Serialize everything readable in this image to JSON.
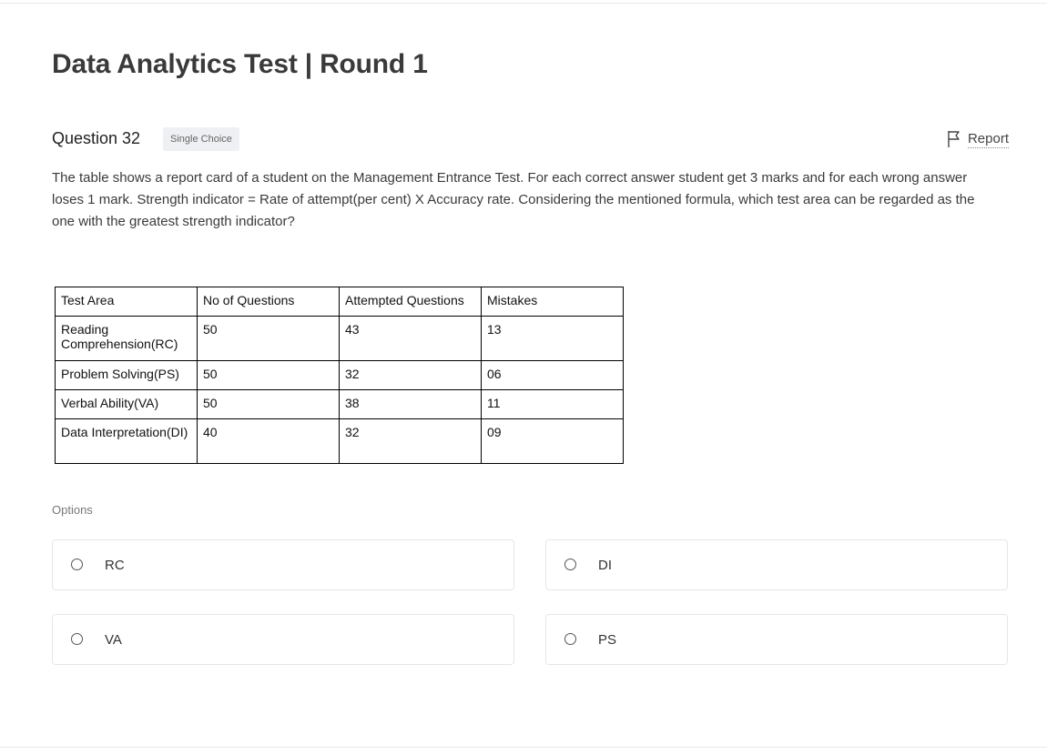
{
  "page": {
    "title": "Data Analytics Test | Round 1"
  },
  "question": {
    "number_label": "Question 32",
    "type_badge": "Single Choice",
    "report_label": "Report",
    "report_icon": "flag-icon",
    "text": "The table shows a report card of a student on the Management Entrance Test. For each correct answer student get 3 marks and for each wrong answer loses 1 mark. Strength indicator = Rate of attempt(per cent) X Accuracy rate. Considering the mentioned formula, which test area can be regarded as the one with the greatest strength indicator?"
  },
  "table": {
    "headers": [
      "Test Area",
      "No of Questions",
      "Attempted Questions",
      "Mistakes"
    ],
    "rows": [
      [
        "Reading Comprehension(RC)",
        "50",
        "43",
        "13"
      ],
      [
        "Problem Solving(PS)",
        "50",
        "32",
        "06"
      ],
      [
        "Verbal Ability(VA)",
        "50",
        "38",
        "11"
      ],
      [
        "Data Interpretation(DI)",
        "40",
        "32",
        "09"
      ]
    ]
  },
  "options": {
    "label": "Options",
    "items": [
      {
        "text": "RC",
        "selected": false
      },
      {
        "text": "DI",
        "selected": false
      },
      {
        "text": "VA",
        "selected": false
      },
      {
        "text": "PS",
        "selected": false
      }
    ]
  }
}
